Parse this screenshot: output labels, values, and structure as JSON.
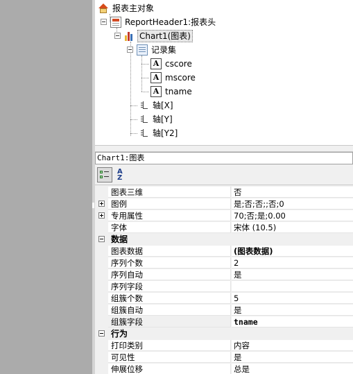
{
  "tree": {
    "root": "报表主对象",
    "report_header": "ReportHeader1:报表头",
    "chart": "Chart1(图表)",
    "recordset": "记录集",
    "fields": [
      "cscore",
      "mscore",
      "tname"
    ],
    "field_icon_glyph": "A",
    "axes": [
      "轴[X]",
      "轴[Y]",
      "轴[Y2]"
    ]
  },
  "object_selector": {
    "value": "Chart1:图表"
  },
  "toolbar": {
    "sort_alpha_glyph_top": "A",
    "sort_alpha_glyph_bottom": "Z"
  },
  "properties": {
    "top_rows": [
      {
        "name": "图表三维",
        "value": "否",
        "expandable": false
      },
      {
        "name": "图例",
        "value": "是;否;否;;否;0",
        "expandable": true
      },
      {
        "name": "专用属性",
        "value": "70;否;是;0.00",
        "expandable": true
      },
      {
        "name": "字体",
        "value": "宋体 (10.5)",
        "expandable": false
      }
    ],
    "data_category": "数据",
    "data_rows": [
      {
        "name": "图表数据",
        "value": "(图表数据)",
        "style": "bold"
      },
      {
        "name": "序列个数",
        "value": "2"
      },
      {
        "name": "序列自动",
        "value": "是"
      },
      {
        "name": "序列字段",
        "value": ""
      },
      {
        "name": "组簇个数",
        "value": "5"
      },
      {
        "name": "组簇自动",
        "value": "是"
      },
      {
        "name": "组簇字段",
        "value": "tname",
        "style": "mono-bold"
      }
    ],
    "behavior_category": "行为",
    "behavior_rows": [
      {
        "name": "打印类别",
        "value": "内容"
      },
      {
        "name": "可见性",
        "value": "是"
      },
      {
        "name": "伸展位移",
        "value": "总是"
      }
    ]
  },
  "colors": {
    "left_pane": "#ababab",
    "grid_background": "#f0f0f0",
    "chart_bars": [
      "#e8b431",
      "#c33a2b",
      "#3a6fb5"
    ]
  }
}
